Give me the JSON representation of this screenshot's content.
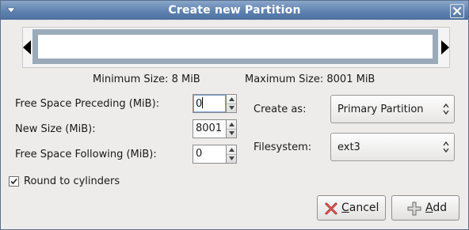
{
  "window": {
    "title": "Create new Partition"
  },
  "sizes": {
    "minimum_label": "Minimum Size: 8 MiB",
    "maximum_label": "Maximum Size: 8001 MiB"
  },
  "fields": {
    "free_preceding": {
      "label": "Free Space Preceding (MiB):",
      "value": "0"
    },
    "new_size": {
      "label": "New Size (MiB):",
      "value": "8001"
    },
    "free_following": {
      "label": "Free Space Following (MiB):",
      "value": "0"
    }
  },
  "create_as": {
    "label": "Create as:",
    "value": "Primary Partition"
  },
  "filesystem": {
    "label": "Filesystem:",
    "value": "ext3"
  },
  "round_cylinders": {
    "label": "Round to cylinders",
    "checked": true
  },
  "buttons": {
    "cancel": "Cancel",
    "add": "Add"
  },
  "colors": {
    "titlebar": "#5f82b0",
    "partition_bar": "#9aaab9",
    "cancel_icon": "#b02a2a"
  },
  "icons": {
    "window_menu": "window-menu-icon",
    "close": "close-icon",
    "cancel": "cancel-x-icon",
    "add": "plus-icon"
  }
}
